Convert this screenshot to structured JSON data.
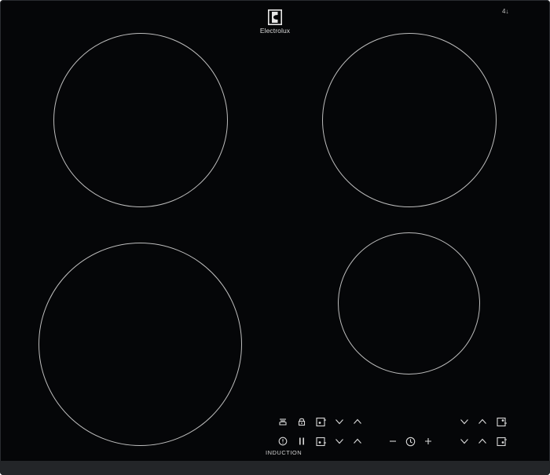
{
  "brand": {
    "name": "Electrolux",
    "series_label": "INDUCTION",
    "corner_mark": "4↓"
  },
  "cooking_zones": [
    {
      "id": "front-left",
      "name": "cooking-zone-rear-left"
    },
    {
      "id": "rear-right",
      "name": "cooking-zone-rear-right"
    },
    {
      "id": "front-left",
      "name": "cooking-zone-front-left"
    },
    {
      "id": "front-right",
      "name": "cooking-zone-front-right"
    }
  ],
  "controls": {
    "row1": [
      "hob2hood-icon",
      "lock-icon",
      "zone-select-icon",
      "chevron-down-icon",
      "chevron-up-icon"
    ],
    "row1_right": [
      "chevron-down-icon",
      "chevron-up-icon",
      "zone-select-icon"
    ],
    "row2": [
      "power-icon",
      "pause-icon",
      "zone-select-icon",
      "chevron-down-icon",
      "chevron-up-icon"
    ],
    "timer": [
      "minus-icon",
      "timer-icon",
      "plus-icon"
    ],
    "row2_right": [
      "chevron-down-icon",
      "chevron-up-icon",
      "zone-select-icon"
    ]
  },
  "colors": {
    "glass": "#050608",
    "zone_outline": "#bdbdbd",
    "strip": "#232528",
    "icon": "#d8d8d8"
  }
}
